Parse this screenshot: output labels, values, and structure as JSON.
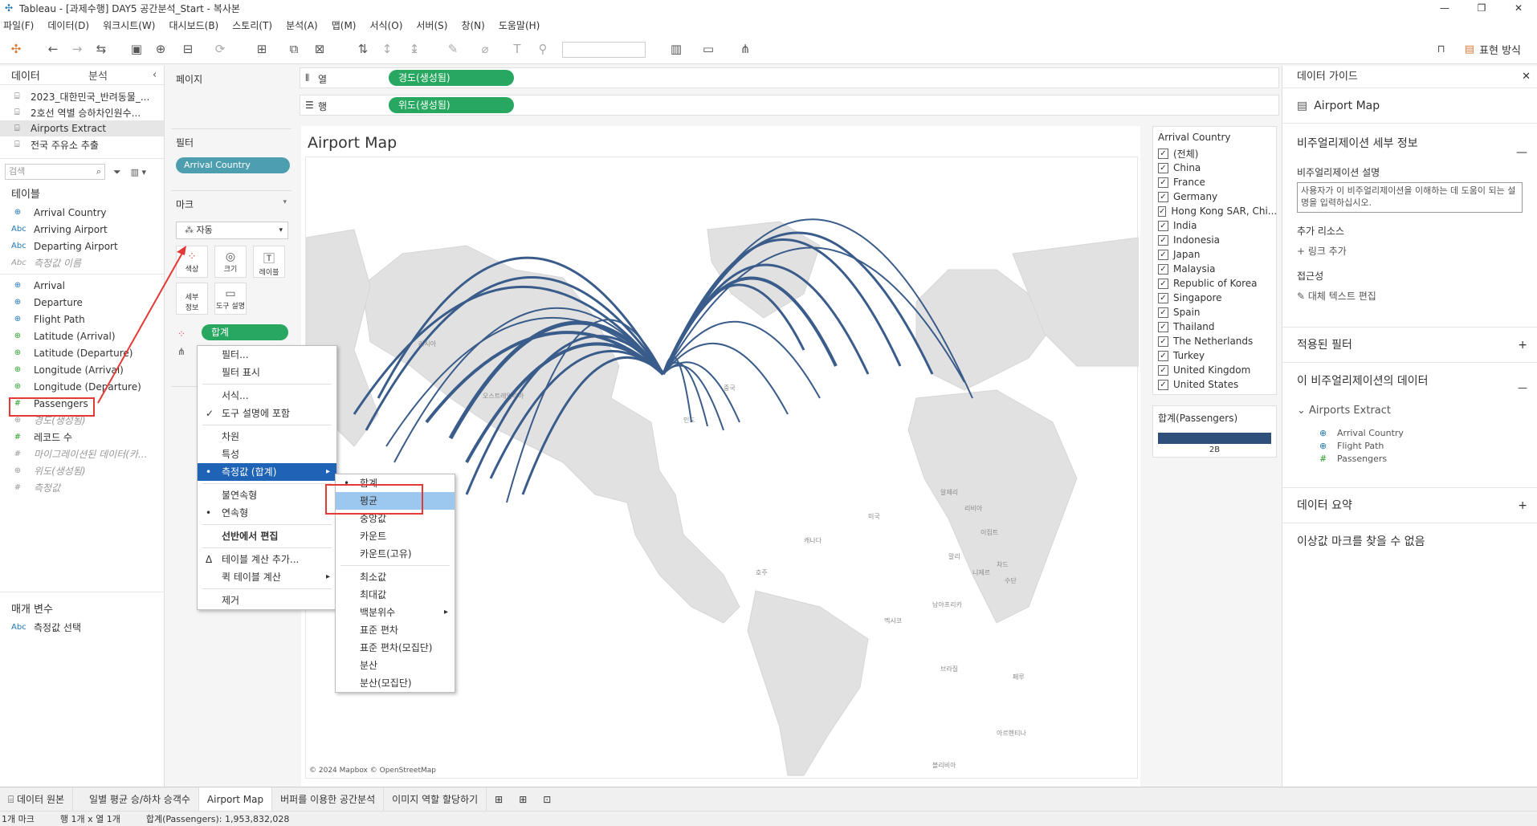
{
  "window": {
    "title": "Tableau - [과제수행] DAY5 공간분석_Start - 복사본",
    "buttons": [
      "—",
      "❐",
      "✕"
    ]
  },
  "menu": [
    "파일(F)",
    "데이터(D)",
    "워크시트(W)",
    "대시보드(B)",
    "스토리(T)",
    "분석(A)",
    "맵(M)",
    "서식(O)",
    "서버(S)",
    "창(N)",
    "도움말(H)"
  ],
  "toolbar": {
    "present_label": "표현 방식"
  },
  "left_pane": {
    "tab_data": "데이터",
    "tab_analysis": "분석",
    "datasources": [
      {
        "label": "2023_대한민국_반려동물_...",
        "selected": false
      },
      {
        "label": "2호선 역별 승하차인원수...",
        "selected": false
      },
      {
        "label": "Airports Extract",
        "selected": true
      },
      {
        "label": "전국 주유소 추출",
        "selected": false
      }
    ],
    "search_placeholder": "검색",
    "tables_title": "테이블",
    "fields_dim": [
      {
        "icon": "⊕",
        "type": "blue",
        "label": "Arrival Country"
      },
      {
        "icon": "Abc",
        "type": "blue",
        "label": "Arriving Airport"
      },
      {
        "icon": "Abc",
        "type": "blue",
        "label": "Departing Airport"
      },
      {
        "icon": "Abc",
        "type": "gray",
        "label": "측정값 이름"
      }
    ],
    "fields_meas": [
      {
        "icon": "⊕",
        "type": "blue",
        "label": "Arrival"
      },
      {
        "icon": "⊕",
        "type": "blue",
        "label": "Departure"
      },
      {
        "icon": "⊕",
        "type": "blue",
        "label": "Flight Path"
      },
      {
        "icon": "⊕",
        "type": "green",
        "label": "Latitude (Arrival)"
      },
      {
        "icon": "⊕",
        "type": "green",
        "label": "Latitude (Departure)"
      },
      {
        "icon": "⊕",
        "type": "green",
        "label": "Longitude (Arrival)"
      },
      {
        "icon": "⊕",
        "type": "green",
        "label": "Longitude (Departure)"
      },
      {
        "icon": "#",
        "type": "green",
        "label": "Passengers"
      },
      {
        "icon": "⊕",
        "type": "gray",
        "label": "경도(생성됨)"
      },
      {
        "icon": "#",
        "type": "green",
        "label": "레코드 수"
      },
      {
        "icon": "#",
        "type": "gray",
        "label": "마이그레이션된 데이터(카..."
      },
      {
        "icon": "⊕",
        "type": "gray",
        "label": "위도(생성됨)"
      },
      {
        "icon": "#",
        "type": "gray",
        "label": "측정값"
      }
    ],
    "params_title": "매개 변수",
    "param_icon": "Abc",
    "param": "측정값 선택"
  },
  "pages_label": "페이지",
  "filters_label": "필터",
  "filter_pill": "Arrival Country",
  "marks": {
    "title": "마크",
    "type": "자동",
    "buttons": {
      "color": "색상",
      "size": "크기",
      "label": "레이블",
      "detail": "세부\n정보",
      "tooltip": "도구 설명"
    },
    "pill": "합계(Passengers)"
  },
  "shelves": {
    "columns_label": "열",
    "rows_label": "행",
    "columns_pill": "경도(생성됨)",
    "rows_pill": "위도(생성됨)"
  },
  "sheet": {
    "title": "Airport Map",
    "attribution": "© 2024 Mapbox © OpenStreetMap"
  },
  "map_labels": [
    "러시아",
    "중국",
    "인도",
    "호주",
    "캐나다",
    "미국",
    "멕시코",
    "브라질",
    "페루",
    "볼리비아",
    "아르헨티나",
    "오스트레일리아",
    "알제리",
    "리비아",
    "이집트",
    "니제르",
    "말리",
    "차드",
    "수단",
    "남아프리카"
  ],
  "filter_card": {
    "title": "Arrival Country",
    "items": [
      "(전체)",
      "China",
      "France",
      "Germany",
      "Hong Kong SAR, Chi...",
      "India",
      "Indonesia",
      "Japan",
      "Malaysia",
      "Republic of Korea",
      "Singapore",
      "Spain",
      "Thailand",
      "The Netherlands",
      "Turkey",
      "United Kingdom",
      "United States"
    ]
  },
  "size_legend": {
    "title": "합계(Passengers)",
    "value": "2B"
  },
  "context_menu": [
    {
      "label": "필터...",
      "mark": "",
      "sub": false
    },
    {
      "label": "필터 표시",
      "mark": "",
      "sub": false
    },
    {
      "sep": true
    },
    {
      "label": "서식...",
      "mark": "",
      "sub": false
    },
    {
      "label": "도구 설명에 포함",
      "mark": "✓",
      "sub": false
    },
    {
      "sep": true
    },
    {
      "label": "차원",
      "mark": "",
      "sub": false
    },
    {
      "label": "특성",
      "mark": "",
      "sub": false
    },
    {
      "label": "측정값 (합계)",
      "mark": "•",
      "sub": true,
      "highlight": true
    },
    {
      "sep": true
    },
    {
      "label": "불연속형",
      "mark": "",
      "sub": false
    },
    {
      "label": "연속형",
      "mark": "•",
      "sub": false
    },
    {
      "sep": true
    },
    {
      "label": "선반에서 편집",
      "mark": "",
      "sub": false,
      "bold": true
    },
    {
      "sep": true
    },
    {
      "label": "테이블 계산 추가...",
      "mark": "Δ",
      "sub": false
    },
    {
      "label": "퀵 테이블 계산",
      "mark": "",
      "sub": true
    },
    {
      "sep": true
    },
    {
      "label": "제거",
      "mark": "",
      "sub": false
    }
  ],
  "sub_menu": [
    {
      "label": "합계",
      "mark": "•"
    },
    {
      "label": "평균",
      "mark": "",
      "highlight": true
    },
    {
      "label": "중앙값",
      "mark": ""
    },
    {
      "label": "카운트",
      "mark": ""
    },
    {
      "label": "카운트(고유)",
      "mark": ""
    },
    {
      "sep": true
    },
    {
      "label": "최소값",
      "mark": ""
    },
    {
      "label": "최대값",
      "mark": ""
    },
    {
      "label": "백분위수",
      "mark": "",
      "sub": true
    },
    {
      "label": "표준 편차",
      "mark": ""
    },
    {
      "label": "표준 편차(모집단)",
      "mark": ""
    },
    {
      "label": "분산",
      "mark": ""
    },
    {
      "label": "분산(모집단)",
      "mark": ""
    }
  ],
  "guide": {
    "header": "데이터 가이드",
    "sheet_name": "Airport Map",
    "viz_detail_title": "비주얼리제이션 세부 정보",
    "desc_label": "비주얼리제이션 설명",
    "desc_placeholder": "사용자가 이 비주얼리제이션을 이해하는 데 도움이 되는 설명을 입력하십시오.",
    "resources_label": "추가 리소스",
    "add_link": "링크 추가",
    "access_label": "접근성",
    "alt_text": "대체 텍스트 편집",
    "applied_filters": "적용된 필터",
    "data_in_viz": "이 비주얼리제이션의 데이터",
    "extract_name": "Airports Extract",
    "extract_fields": [
      {
        "icon": "⊕",
        "label": "Arrival Country"
      },
      {
        "icon": "⊕",
        "label": "Flight Path"
      },
      {
        "icon": "#",
        "label": "Passengers"
      }
    ],
    "data_summary": "데이터 요약",
    "no_outliers": "이상값 마크를 찾을 수 없음"
  },
  "tabs": [
    {
      "label": "데이터 원본",
      "active": false
    },
    {
      "label": "일별 평균 승/하차 승객수",
      "active": false
    },
    {
      "label": "Airport Map",
      "active": true
    },
    {
      "label": "버퍼를 이용한 공간분석",
      "active": false
    },
    {
      "label": "이미지 역할 할당하기",
      "active": false
    }
  ],
  "status": {
    "marks": "1개 마크",
    "rows_cols": "행 1개 x 열 1개",
    "sum": "합계(Passengers): 1,953,832,028"
  },
  "colors": {
    "flight_path": "#2e4f7a",
    "green_pill": "#27a760",
    "teal_pill": "#4d9fb0",
    "highlight": "#1e63b6",
    "annotation": "#e53935"
  }
}
